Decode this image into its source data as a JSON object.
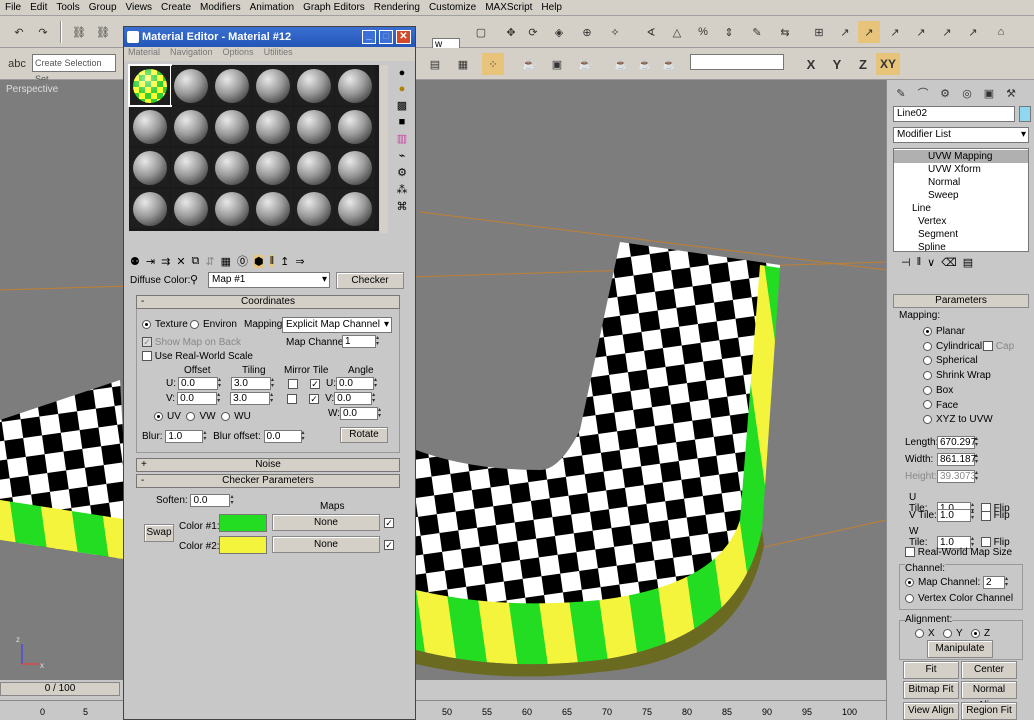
{
  "menubar": [
    "File",
    "Edit",
    "Tools",
    "Group",
    "Views",
    "Create",
    "Modifiers",
    "Animation",
    "Graph Editors",
    "Rendering",
    "Customize",
    "MAXScript",
    "Help"
  ],
  "toolbar": {
    "selection_set_placeholder": "Create Selection Set",
    "axis_x": "X",
    "axis_y": "Y",
    "axis_z": "Z",
    "axis_xy": "XY",
    "view_dropdown": "w"
  },
  "viewport": {
    "label": "Perspective"
  },
  "command_panel": {
    "object_name": "Line02",
    "modifier_list_label": "Modifier List",
    "stack": [
      {
        "label": "UVW Mapping",
        "selected": true
      },
      {
        "label": "UVW Xform"
      },
      {
        "label": "Normal"
      },
      {
        "label": "Sweep"
      },
      {
        "label": "Line"
      },
      {
        "label": "Vertex"
      },
      {
        "label": "Segment"
      },
      {
        "label": "Spline"
      }
    ],
    "parameters_title": "Parameters",
    "mapping_label": "Mapping:",
    "mapping_options": [
      "Planar",
      "Cylindrical",
      "Spherical",
      "Shrink Wrap",
      "Box",
      "Face",
      "XYZ to UVW"
    ],
    "cap_label": "Cap",
    "length_label": "Length:",
    "length_value": "670.297",
    "width_label": "Width:",
    "width_value": "861.187",
    "height_label": "Height:",
    "height_value": "39.3073",
    "utile_label": "U Tile:",
    "utile_value": "1.0",
    "vtile_label": "V Tile:",
    "vtile_value": "1.0",
    "wtile_label": "W Tile:",
    "wtile_value": "1.0",
    "flip_label": "Flip",
    "realworld_label": "Real-World Map Size",
    "channel_label": "Channel:",
    "map_channel_label": "Map Channel:",
    "map_channel_value": "2",
    "vertex_color_label": "Vertex Color Channel",
    "alignment_label": "Alignment:",
    "align_x": "X",
    "align_y": "Y",
    "align_z": "Z",
    "manipulate": "Manipulate",
    "fit": "Fit",
    "center": "Center",
    "bitmap_fit": "Bitmap Fit",
    "normal_align": "Normal Align",
    "view_align": "View Align",
    "region_fit": "Region Fit"
  },
  "material_editor": {
    "title": "Material Editor - Material #12",
    "menu": [
      "Material",
      "Navigation",
      "Options",
      "Utilities"
    ],
    "diffuse_label": "Diffuse Color:",
    "map_name": "Map #1",
    "map_type": "Checker",
    "coordinates_title": "Coordinates",
    "texture_label": "Texture",
    "environ_label": "Environ",
    "mapping_label": "Mapping:",
    "mapping_value": "Explicit Map Channel",
    "show_map_label": "Show Map on Back",
    "map_channel_label": "Map Channel:",
    "map_channel_value": "1",
    "realworld_label": "Use Real-World Scale",
    "offset_label": "Offset",
    "tiling_label": "Tiling",
    "mirror_tile_label": "Mirror Tile",
    "angle_label": "Angle",
    "u_label": "U:",
    "v_label": "V:",
    "w_label": "W:",
    "u_offset": "0.0",
    "v_offset": "0.0",
    "u_tiling": "3.0",
    "v_tiling": "3.0",
    "u_angle": "0.0",
    "v_angle": "0.0",
    "w_angle": "0.0",
    "uv_label": "UV",
    "vw_label": "VW",
    "wu_label": "WU",
    "blur_label": "Blur:",
    "blur_value": "1.0",
    "blur_offset_label": "Blur offset:",
    "blur_offset_value": "0.0",
    "rotate_label": "Rotate",
    "noise_title": "Noise",
    "checker_params_title": "Checker Parameters",
    "soften_label": "Soften:",
    "soften_value": "0.0",
    "maps_label": "Maps",
    "swap_label": "Swap",
    "color1_label": "Color #1:",
    "color1": "#22dd22",
    "color2_label": "Color #2:",
    "color2": "#f4f43c",
    "none1": "None",
    "none2": "None"
  },
  "timeline": {
    "frame_counter": "0 / 100",
    "ticks": [
      "0",
      "5",
      "50",
      "55",
      "60",
      "65",
      "70",
      "75",
      "80",
      "85",
      "90",
      "95",
      "100"
    ]
  },
  "colors": {
    "checker_green": "#22dd22",
    "checker_yellow": "#f4f43c",
    "titlebar": "#2456b8"
  }
}
